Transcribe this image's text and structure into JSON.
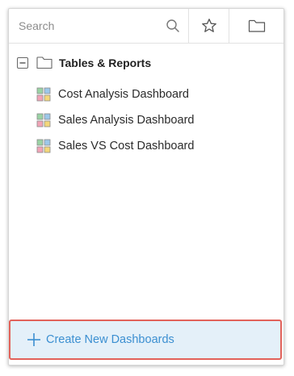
{
  "toolbar": {
    "search_placeholder": "Search",
    "search_icon": "search-icon",
    "favorites_icon": "star-icon",
    "folder_icon": "folder-icon"
  },
  "tree": {
    "root": {
      "label": "Tables & Reports",
      "expanded": true,
      "collapse_icon": "minus-box-icon",
      "icon": "folder-icon"
    },
    "items": [
      {
        "label": "Cost Analysis Dashboard",
        "icon": "dashboard-icon"
      },
      {
        "label": "Sales Analysis Dashboard",
        "icon": "dashboard-icon"
      },
      {
        "label": "Sales VS Cost Dashboard",
        "icon": "dashboard-icon"
      }
    ]
  },
  "footer": {
    "create_label": "Create New Dashboards",
    "icon": "plus-icon"
  },
  "colors": {
    "link_blue": "#3b8fd1",
    "footer_bg": "#e4f0f9",
    "highlight_border": "#e2625a",
    "dash_green": "#9ad3a4",
    "dash_blue": "#9cc8ea",
    "dash_pink": "#f2a4b7",
    "dash_yellow": "#f3d77a"
  }
}
